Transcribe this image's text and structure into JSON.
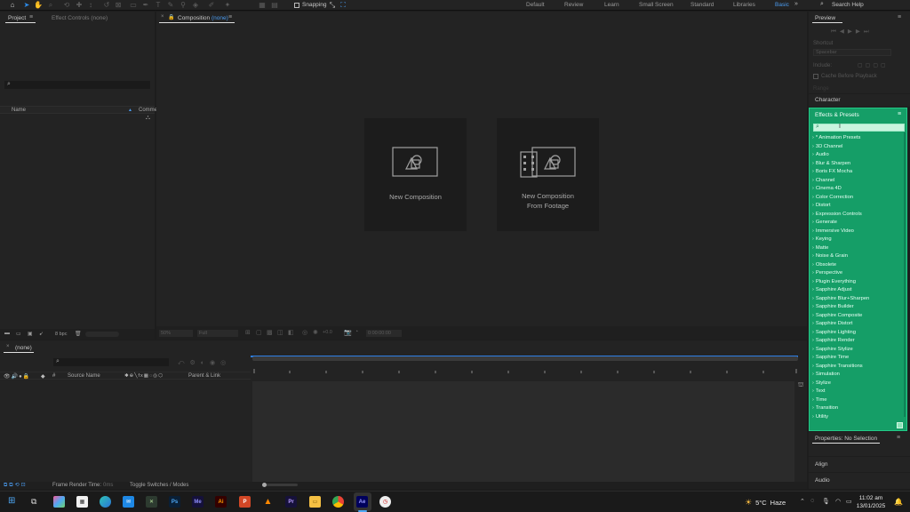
{
  "toolbar": {
    "snapping_label": "Snapping",
    "workspaces": [
      {
        "label": "Default",
        "active": false
      },
      {
        "label": "Review",
        "active": false
      },
      {
        "label": "Learn",
        "active": false
      },
      {
        "label": "Small Screen",
        "active": false
      },
      {
        "label": "Standard",
        "active": false
      },
      {
        "label": "Libraries",
        "active": false
      },
      {
        "label": "Basic",
        "active": true
      }
    ],
    "help_search_placeholder": "Search Help"
  },
  "project_panel": {
    "tab_project": "Project",
    "tab_effect_controls": "Effect Controls (none)",
    "col_name": "Name",
    "col_comment": "Comme",
    "bpc_label": "8 bpc"
  },
  "composition_panel": {
    "tab_label": "Composition",
    "tab_suffix": "(none)",
    "card_new_comp": "New Composition",
    "card_from_footage_line1": "New Composition",
    "card_from_footage_line2": "From Footage",
    "footer_zoom": "50%",
    "footer_resolution": "Full",
    "footer_exposure": "+0.0",
    "footer_timecode": "0:00:00:00"
  },
  "preview_panel": {
    "title": "Preview",
    "shortcut_label": "Shortcut",
    "shortcut_value": "Spacebar",
    "include_label": "Include:",
    "cache_label": "Cache Before Playback",
    "range_label": "Range"
  },
  "character_panel": {
    "title": "Character"
  },
  "effects_panel": {
    "title": "Effects & Presets",
    "search_value": "",
    "items": [
      "* Animation Presets",
      "3D Channel",
      "Audio",
      "Blur & Sharpen",
      "Boris FX Mocha",
      "Channel",
      "Cinema 4D",
      "Color Correction",
      "Distort",
      "Expression Controls",
      "Generate",
      "Immersive Video",
      "Keying",
      "Matte",
      "Noise & Grain",
      "Obsolete",
      "Perspective",
      "Plugin Everything",
      "Sapphire Adjust",
      "Sapphire Blur+Sharpen",
      "Sapphire Builder",
      "Sapphire Composite",
      "Sapphire Distort",
      "Sapphire Lighting",
      "Sapphire Render",
      "Sapphire Stylize",
      "Sapphire Time",
      "Sapphire Transitions",
      "Simulation",
      "Stylize",
      "Text",
      "Time",
      "Transition",
      "Utility"
    ]
  },
  "properties_panel": {
    "title": "Properties: No Selection"
  },
  "align_panel": {
    "title": "Align"
  },
  "audio_panel": {
    "title": "Audio"
  },
  "timeline": {
    "tab_label": "(none)",
    "col_source_name": "Source Name",
    "col_parent_link": "Parent & Link",
    "footer_render_label": "Frame Render Time:",
    "footer_render_value": "0ms",
    "footer_toggle": "Toggle Switches / Modes"
  },
  "taskbar": {
    "weather_temp": "5°C",
    "weather_text": "Haze",
    "time": "11:02 am",
    "date": "13/01/2025",
    "apps": [
      "copilot",
      "store",
      "edge",
      "mail",
      "photoshop",
      "media-encoder",
      "illustrator",
      "powerpoint",
      "vlc",
      "premiere-pro",
      "file-explorer",
      "chrome",
      "after-effects",
      "stopwatch"
    ]
  }
}
